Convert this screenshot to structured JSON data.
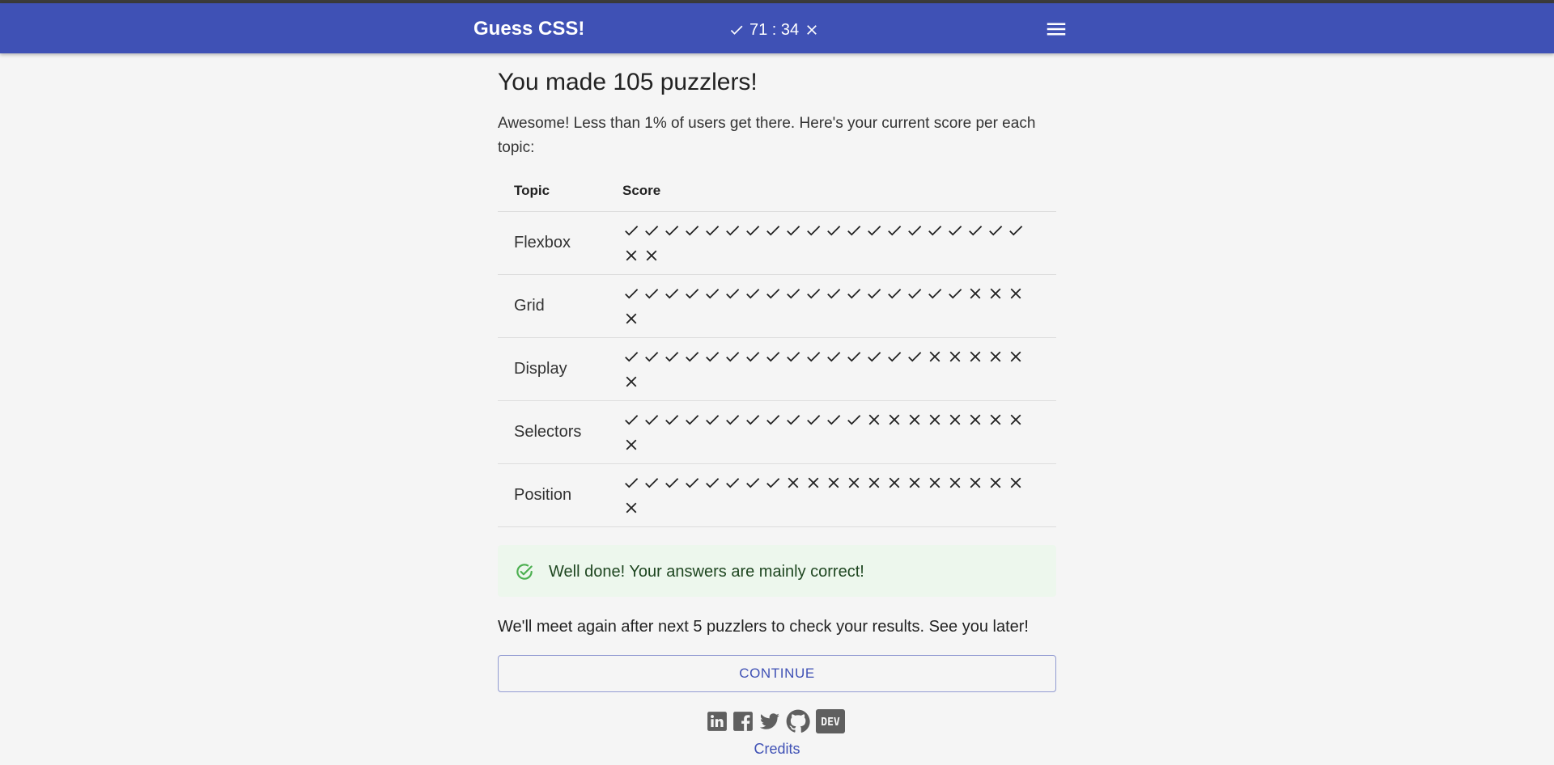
{
  "app": {
    "title": "Guess CSS!",
    "correct_count": "71 : 34",
    "colors": {
      "primary": "#3f51b5",
      "success": "#4caf50",
      "alert_bg": "#edf7ed"
    }
  },
  "main": {
    "heading": "You made 105 puzzlers!",
    "intro": "Awesome! Less than 1% of users get there. Here's your current score per each topic:",
    "table": {
      "headers": [
        "Topic",
        "Score"
      ],
      "rows": [
        {
          "topic": "Flexbox",
          "correct": 20,
          "wrong": 2
        },
        {
          "topic": "Grid",
          "correct": 17,
          "wrong": 4
        },
        {
          "topic": "Display",
          "correct": 15,
          "wrong": 6
        },
        {
          "topic": "Selectors",
          "correct": 12,
          "wrong": 9
        },
        {
          "topic": "Position",
          "correct": 8,
          "wrong": 13
        }
      ]
    },
    "alert_text": "Well done! Your answers are mainly correct!",
    "followup": "We'll meet again after next 5 puzzlers to check your results. See you later!",
    "continue_label": "CONTINUE"
  },
  "footer": {
    "social_icons": [
      "linkedin-icon",
      "facebook-icon",
      "twitter-icon",
      "github-icon",
      "dev-icon"
    ],
    "dev_label": "DEV",
    "credits_label": "Credits"
  }
}
